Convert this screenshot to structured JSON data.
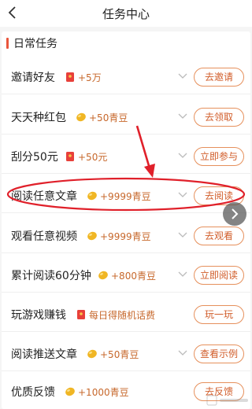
{
  "header": {
    "title": "任务中心",
    "back_icon": "back-arrow-icon"
  },
  "section": {
    "title": "日常任务",
    "accent": "#e9553c"
  },
  "tasks": [
    {
      "name": "邀请好友",
      "reward": "+5万",
      "reward_icon": "red-envelope-icon",
      "action": "去邀请"
    },
    {
      "name": "天天种红包",
      "reward": "+50青豆",
      "reward_icon": "bean-icon",
      "action": "去领取"
    },
    {
      "name": "刮分50元",
      "reward": "+50元",
      "reward_icon": "red-envelope-icon",
      "action": "立即参与"
    },
    {
      "name": "阅读任意文章",
      "reward": "+9999青豆",
      "reward_icon": "bean-icon",
      "action": "去阅读"
    },
    {
      "name": "观看任意视频",
      "reward": "+9999青豆",
      "reward_icon": "bean-icon",
      "action": "去观看"
    },
    {
      "name": "累计阅读60分钟",
      "reward": "+800青豆",
      "reward_icon": "bean-icon",
      "action": "立即阅读"
    },
    {
      "name": "玩游戏赚钱",
      "reward": "每日得随机话费",
      "reward_icon": "red-envelope-icon",
      "action": "玩一玩"
    },
    {
      "name": "阅读推送文章",
      "reward": "+50青豆",
      "reward_icon": "bean-icon",
      "action": "查看示例"
    },
    {
      "name": "优质反馈",
      "reward": "+1000青豆",
      "reward_icon": "bean-icon",
      "action": "去反馈"
    }
  ],
  "colors": {
    "accent": "#e9553c",
    "reward_text": "#c7682c",
    "button_text": "#d15d2a",
    "annotation": "#e0202a"
  }
}
